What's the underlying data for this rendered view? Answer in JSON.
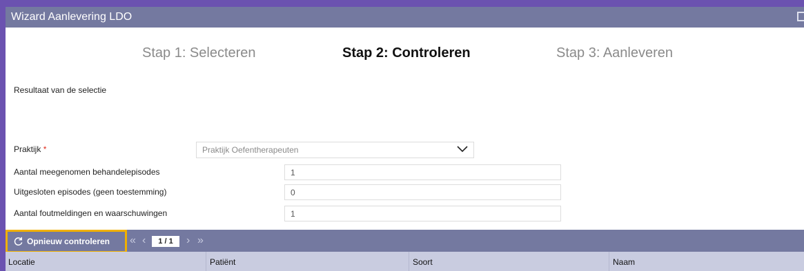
{
  "window": {
    "title": "Wizard Aanlevering LDO"
  },
  "steps": [
    {
      "label": "Stap 1: Selecteren"
    },
    {
      "label": "Stap 2: Controleren"
    },
    {
      "label": "Stap 3: Aanleveren"
    }
  ],
  "section_title": "Resultaat van de selectie",
  "form": {
    "praktijk": {
      "label": "Praktijk",
      "required_mark": "*",
      "value": "Praktijk Oefentherapeuten"
    },
    "fields": [
      {
        "label": "Aantal meegenomen behandelepisodes",
        "value": "1"
      },
      {
        "label": "Uitgesloten episodes (geen toestemming)",
        "value": "0"
      },
      {
        "label": "Aantal foutmeldingen en waarschuwingen",
        "value": "1"
      }
    ]
  },
  "toolbar": {
    "recheck_label": "Opnieuw controleren",
    "recheck_icon": "refresh-icon",
    "pager": {
      "first": "«",
      "prev": "‹",
      "page": "1 / 1",
      "next": "›",
      "last": "»"
    }
  },
  "table": {
    "columns": [
      "Locatie",
      "Patiënt",
      "Soort",
      "Naam"
    ]
  },
  "colors": {
    "background": "#6b52b0",
    "titlebar": "#7479a0",
    "highlight": "#f0b000",
    "header_row": "#c9cce0"
  }
}
